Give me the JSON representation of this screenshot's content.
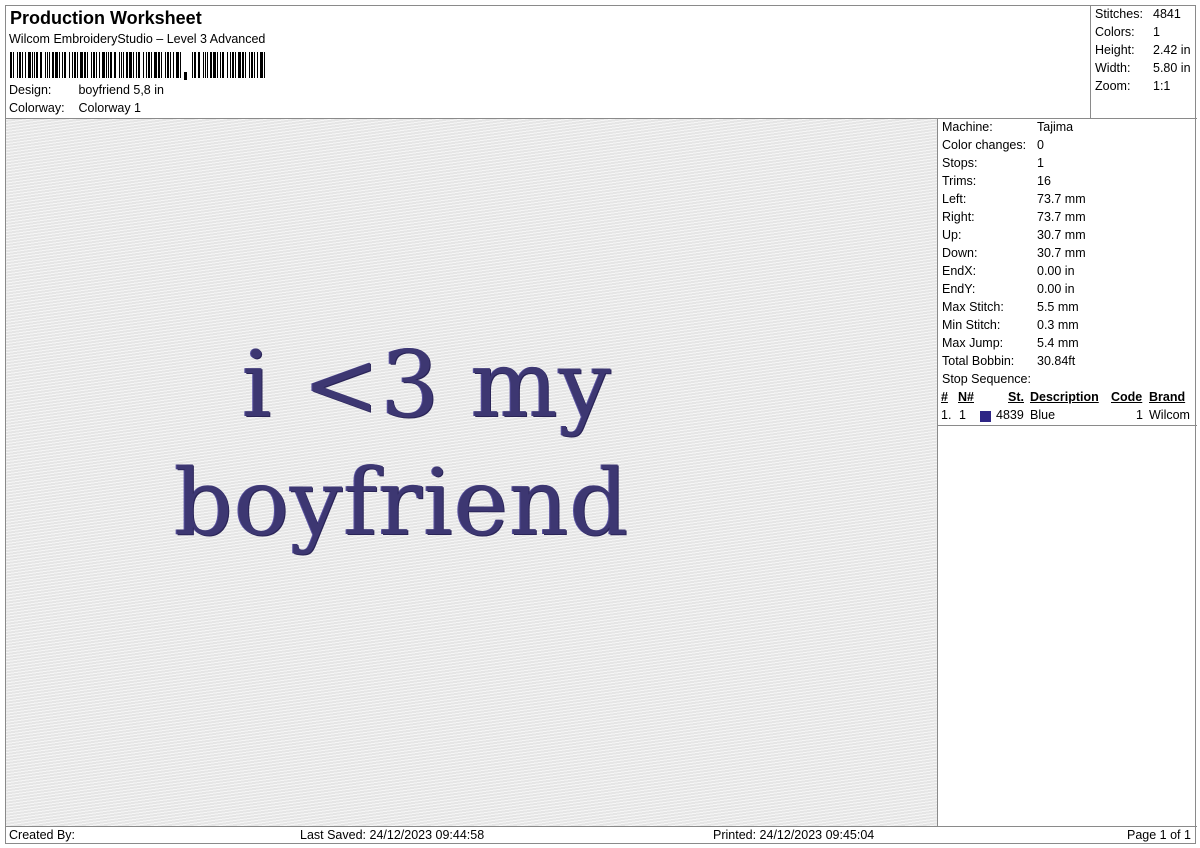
{
  "header": {
    "title": "Production Worksheet",
    "subtitle": "Wilcom EmbroideryStudio – Level 3 Advanced",
    "design_label": "Design:",
    "design_value": "boyfriend 5,8 in",
    "colorway_label": "Colorway:",
    "colorway_value": "Colorway 1"
  },
  "stats": {
    "stitches_label": "Stitches:",
    "stitches_value": "4841",
    "colors_label": "Colors:",
    "colors_value": "1",
    "height_label": "Height:",
    "height_value": "2.42 in",
    "width_label": "Width:",
    "width_value": "5.80 in",
    "zoom_label": "Zoom:",
    "zoom_value": "1:1"
  },
  "preview": {
    "line1": "i <3 my",
    "line2": "boyfriend",
    "thread_color": "#3d3772"
  },
  "info": {
    "rows": [
      {
        "label": "Machine:",
        "value": "Tajima"
      },
      {
        "label": "Color changes:",
        "value": "0"
      },
      {
        "label": "Stops:",
        "value": "1"
      },
      {
        "label": "Trims:",
        "value": "16"
      },
      {
        "label": "Left:",
        "value": "73.7 mm"
      },
      {
        "label": "Right:",
        "value": "73.7 mm"
      },
      {
        "label": "Up:",
        "value": "30.7 mm"
      },
      {
        "label": "Down:",
        "value": "30.7 mm"
      },
      {
        "label": "EndX:",
        "value": "0.00 in"
      },
      {
        "label": "EndY:",
        "value": "0.00 in"
      },
      {
        "label": "Max Stitch:",
        "value": "5.5 mm"
      },
      {
        "label": "Min Stitch:",
        "value": "0.3 mm"
      },
      {
        "label": "Max Jump:",
        "value": "5.4 mm"
      },
      {
        "label": "Total Bobbin:",
        "value": "30.84ft"
      }
    ],
    "stop_sequence_title": "Stop Sequence:",
    "columns": {
      "num": "#",
      "n": "N#",
      "st": "St.",
      "description": "Description",
      "code": "Code",
      "brand": "Brand"
    },
    "stops": [
      {
        "num": "1.",
        "n": "1",
        "st": "4839",
        "description": "Blue",
        "code": "1",
        "brand": "Wilcom",
        "swatch_color": "#2e2585"
      }
    ]
  },
  "footer": {
    "created_by": "Created By:",
    "last_saved": "Last Saved: 24/12/2023 09:44:58",
    "printed": "Printed: 24/12/2023 09:45:04",
    "page": "Page 1 of 1"
  }
}
